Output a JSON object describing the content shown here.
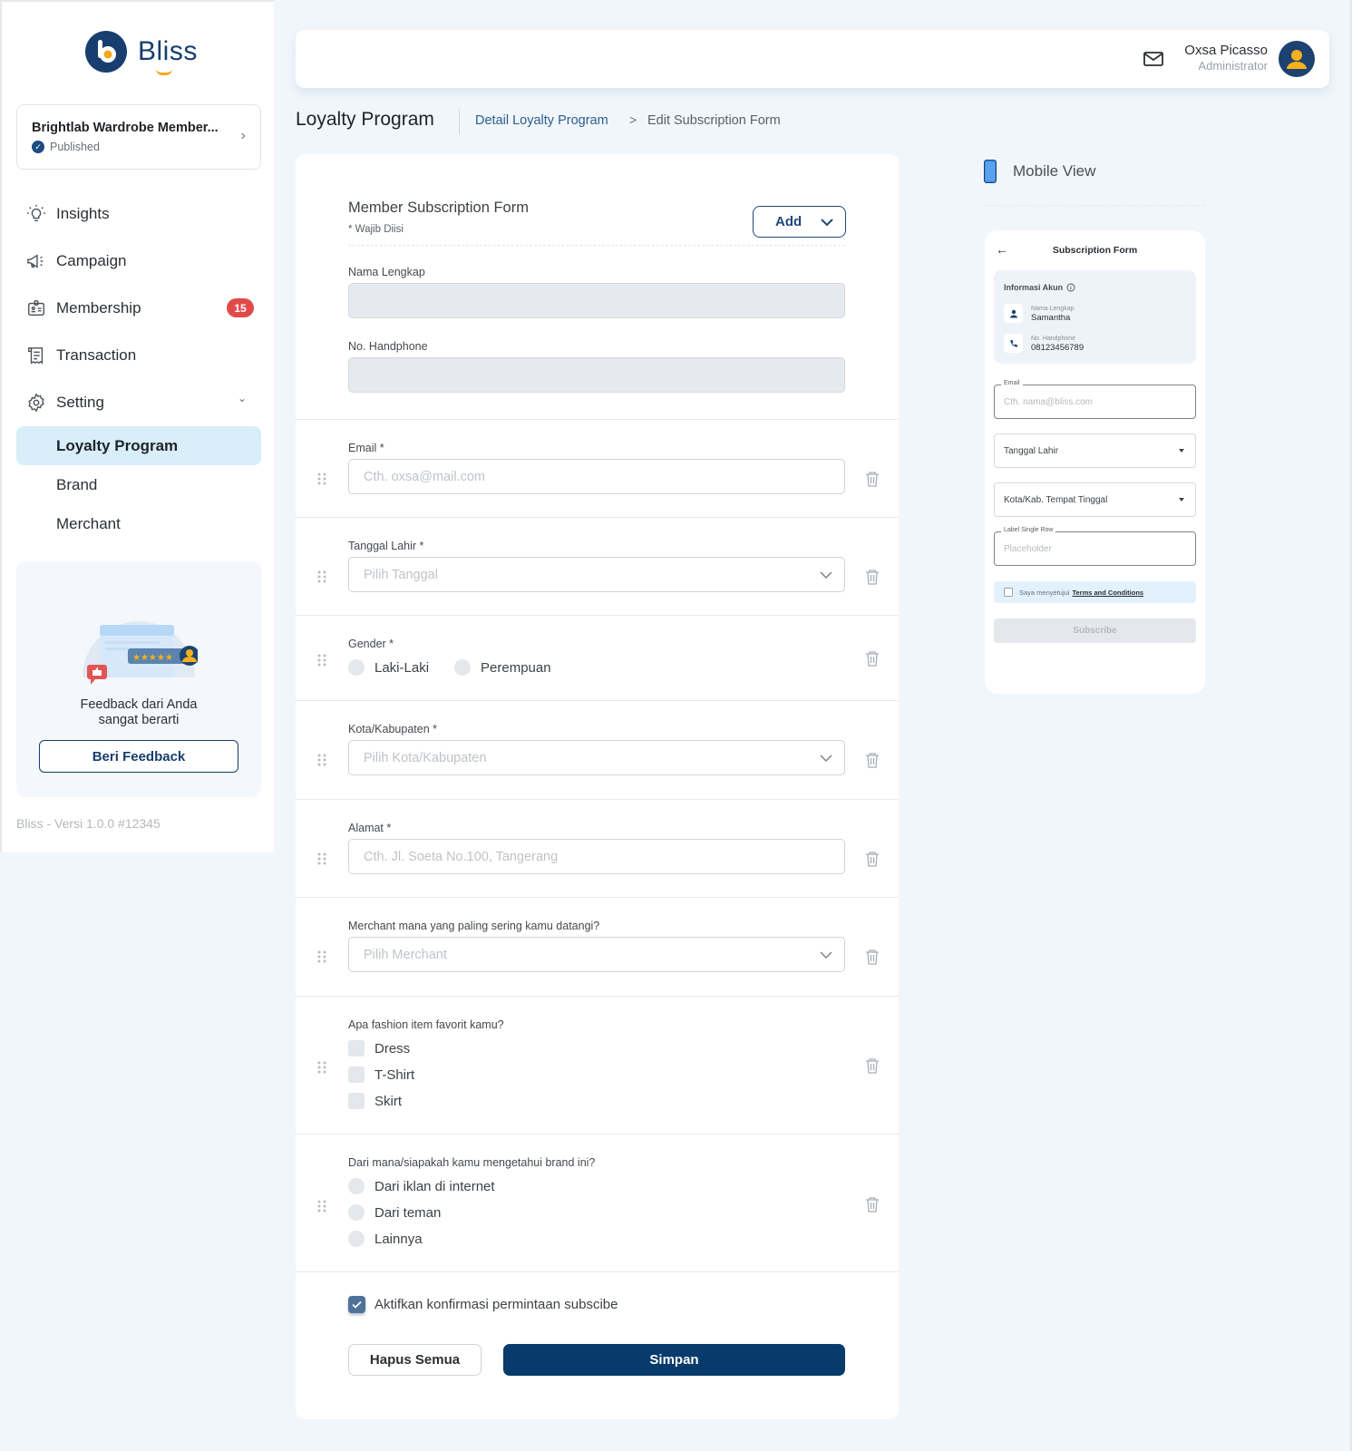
{
  "brand": {
    "name": "Bliss",
    "colors": {
      "primary": "#173e6e",
      "accent": "#f4a81c",
      "danger": "#e24a4a",
      "active_bg": "#d8eef9"
    }
  },
  "program_card": {
    "title": "Brightlab Wardrobe Member...",
    "status": "Published",
    "icon": "verified-badge-icon",
    "chevron": "chevron-right-icon"
  },
  "sidebar": {
    "items": [
      {
        "label": "Insights",
        "icon": "lightbulb-icon"
      },
      {
        "label": "Campaign",
        "icon": "megaphone-icon"
      },
      {
        "label": "Membership",
        "icon": "id-card-icon",
        "badge": "15"
      },
      {
        "label": "Transaction",
        "icon": "receipt-icon"
      },
      {
        "label": "Setting",
        "icon": "gear-icon",
        "expanded": true
      }
    ],
    "sub_items": [
      {
        "label": "Loyalty Program",
        "active": true
      },
      {
        "label": "Brand",
        "active": false
      },
      {
        "label": "Merchant",
        "active": false
      }
    ],
    "feedback": {
      "text_line1": "Feedback dari Anda",
      "text_line2": "sangat berarti",
      "button": "Beri Feedback"
    },
    "version": "Bliss - Versi 1.0.0 #12345"
  },
  "header": {
    "user_name": "Oxsa Picasso",
    "user_role": "Administrator",
    "mail_icon": "mail-icon",
    "avatar_icon": "user-avatar-icon"
  },
  "breadcrumb": {
    "title": "Loyalty Program",
    "link": "Detail Loyalty Program",
    "separator": ">",
    "current": "Edit Subscription Form"
  },
  "form": {
    "title": "Member Subscription Form",
    "required_note": "* Wajib Diisi",
    "add_button": "Add",
    "fixed_fields": [
      {
        "label": "Nama Lengkap",
        "value": ""
      },
      {
        "label": "No. Handphone",
        "value": ""
      }
    ],
    "fields": [
      {
        "type": "text",
        "label": "Email *",
        "placeholder": "Cth. oxsa@mail.com"
      },
      {
        "type": "dropdown",
        "label": "Tanggal Lahir *",
        "placeholder": "Pilih Tanggal"
      },
      {
        "type": "radio",
        "label": "Gender *",
        "options": [
          "Laki-Laki",
          "Perempuan"
        ]
      },
      {
        "type": "dropdown",
        "label": "Kota/Kabupaten *",
        "placeholder": "Pilih Kota/Kabupaten"
      },
      {
        "type": "text",
        "label": "Alamat *",
        "placeholder": "Cth. Jl. Soeta No.100, Tangerang"
      },
      {
        "type": "dropdown",
        "label": "Merchant mana yang paling sering kamu datangi?",
        "placeholder": "Pilih Merchant"
      },
      {
        "type": "checkbox",
        "label": "Apa fashion item favorit kamu?",
        "options": [
          "Dress",
          "T-Shirt",
          "Skirt"
        ]
      },
      {
        "type": "radio",
        "label": "Dari mana/siapakah kamu mengetahui brand ini?",
        "options": [
          "Dari iklan di internet",
          "Dari teman",
          "Lainnya"
        ]
      }
    ],
    "confirm": {
      "label": "Aktifkan konfirmasi permintaan subscibe",
      "checked": true
    },
    "clear_button": "Hapus Semua",
    "save_button": "Simpan"
  },
  "mobile_view": {
    "title": "Mobile View",
    "screen_title": "Subscription Form",
    "info_title": "Informasi Akun",
    "info_rows": [
      {
        "label": "Nama Lengkap",
        "value": "Samantha"
      },
      {
        "label": "No. Handphone",
        "value": "08123456789"
      }
    ],
    "email": {
      "legend": "Email",
      "placeholder": "Cth. nama@bliss.com"
    },
    "birth": "Tanggal Lahir",
    "city": "Kota/Kab. Tempat Tinggal",
    "single_row": {
      "legend": "Label Single Row",
      "placeholder": "Placeholder"
    },
    "terms_prefix": "Saya menyetujui",
    "terms_link": "Terms and Conditions",
    "subscribe": "Subscribe"
  }
}
